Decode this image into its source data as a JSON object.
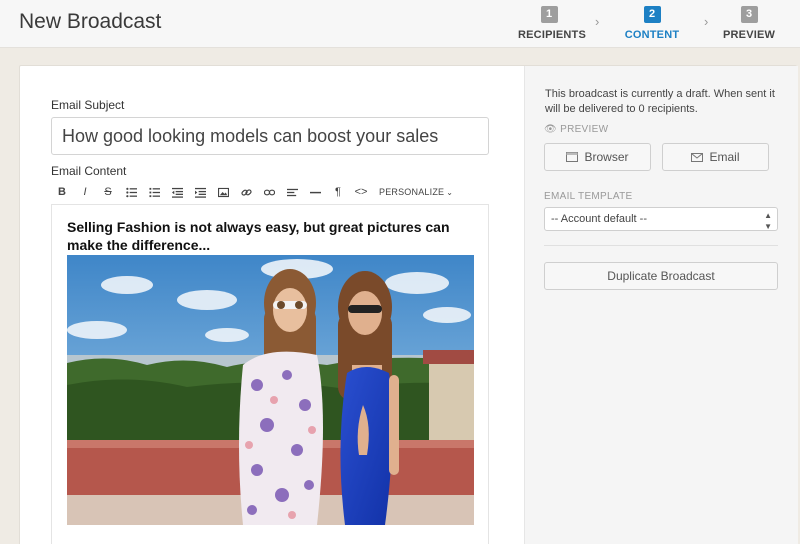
{
  "header": {
    "title": "New Broadcast"
  },
  "steps": [
    {
      "num": "1",
      "label": "RECIPIENTS",
      "active": false
    },
    {
      "num": "2",
      "label": "CONTENT",
      "active": true
    },
    {
      "num": "3",
      "label": "PREVIEW",
      "active": false
    }
  ],
  "form": {
    "subject_label": "Email Subject",
    "subject_value": "How good looking models can boost your sales",
    "content_label": "Email Content"
  },
  "toolbar": {
    "bold": "B",
    "italic": "I",
    "strike": "S",
    "paragraph": "¶",
    "code": "<>",
    "personalize": "PERSONALIZE",
    "icons": [
      "bold-icon",
      "italic-icon",
      "strikethrough-icon",
      "bulleted-list-icon",
      "numbered-list-icon",
      "outdent-icon",
      "indent-icon",
      "image-icon",
      "link-icon",
      "unlink-icon",
      "align-icon",
      "horizontal-rule-icon",
      "paragraph-icon",
      "code-icon"
    ]
  },
  "editor": {
    "headline": "Selling Fashion is not always easy, but great pictures can make the difference..."
  },
  "sidebar": {
    "draft_text": "This broadcast is currently a draft. When sent it will be delivered to 0 recipients.",
    "preview_heading": "PREVIEW",
    "browser_label": "Browser",
    "email_label": "Email",
    "template_heading": "EMAIL TEMPLATE",
    "template_value": "-- Account default --",
    "duplicate_label": "Duplicate Broadcast"
  },
  "colors": {
    "accent": "#1d80c4",
    "step_inactive": "#9e9e9e",
    "background": "#efebe4"
  }
}
